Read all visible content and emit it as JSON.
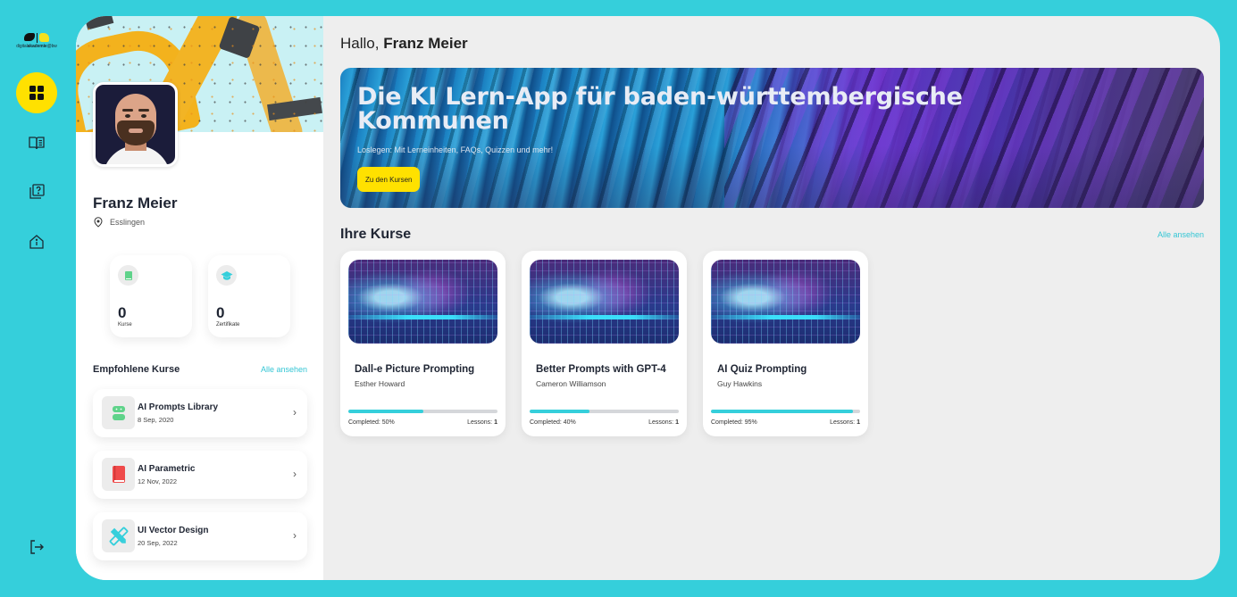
{
  "app": {
    "logo": {
      "brand_light": "digital",
      "brand_bold": "akademie",
      "brand_suffix": "@bw"
    },
    "colors": {
      "accent": "#35cfdb",
      "highlight": "#ffe100",
      "text": "#1f2533",
      "background": "#eeeeee"
    }
  },
  "nav": {
    "items": [
      {
        "name": "dashboard",
        "icon": "grid-icon",
        "active": true
      },
      {
        "name": "courses",
        "icon": "open-book-icon",
        "active": false
      },
      {
        "name": "quizzes",
        "icon": "question-cards-icon",
        "active": false
      },
      {
        "name": "info",
        "icon": "home-info-icon",
        "active": false
      }
    ],
    "logout_icon": "logout-icon"
  },
  "profile": {
    "name": "Franz Meier",
    "location": "Esslingen",
    "stats": [
      {
        "value": "0",
        "label": "Kurse",
        "icon": "book-icon",
        "color": "#5fd38a"
      },
      {
        "value": "0",
        "label": "Zertifikate",
        "icon": "graduation-cap-icon",
        "color": "#35cfdb"
      }
    ],
    "recommended": {
      "title": "Empfohlene Kurse",
      "see_all": "Alle ansehen",
      "items": [
        {
          "title": "AI Prompts Library",
          "date": "8 Sep, 2020",
          "icon": "robot-icon",
          "color": "#5fd38a"
        },
        {
          "title": "AI Parametric",
          "date": "12 Nov, 2022",
          "icon": "book-icon",
          "color": "#ef4a4a"
        },
        {
          "title": "UI Vector Design",
          "date": "20 Sep, 2022",
          "icon": "pencil-ruler-icon",
          "color": "#35cfdb"
        }
      ]
    }
  },
  "main": {
    "greeting_prefix": "Hallo, ",
    "greeting_name": "Franz Meier",
    "hero": {
      "title": "Die KI Lern-App für baden-württembergische Kommunen",
      "subtitle": "Loslegen: Mit Lerneinheiten, FAQs, Quizzen und mehr!",
      "button": "Zu den Kursen"
    },
    "courses": {
      "title": "Ihre Kurse",
      "see_all": "Alle ansehen",
      "items": [
        {
          "title": "Dall-e Picture Prompting",
          "author": "Esther Howard",
          "completed_label": "Completed: 50%",
          "progress": 50,
          "lessons_label": "Lessons:",
          "lessons": "1"
        },
        {
          "title": "Better Prompts with GPT-4",
          "author": "Cameron Williamson",
          "completed_label": "Completed: 40%",
          "progress": 40,
          "lessons_label": "Lessons:",
          "lessons": "1"
        },
        {
          "title": "AI Quiz Prompting",
          "author": "Guy Hawkins",
          "completed_label": "Completed: 95%",
          "progress": 95,
          "lessons_label": "Lessons:",
          "lessons": "1"
        }
      ]
    }
  }
}
